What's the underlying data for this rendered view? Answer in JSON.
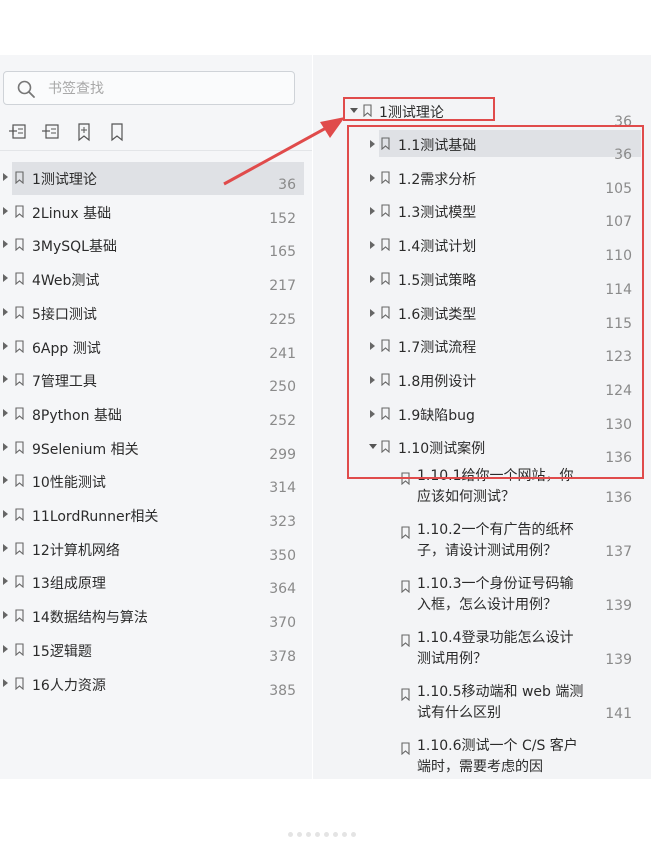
{
  "search": {
    "placeholder": "书签查找"
  },
  "toolbar": {
    "icons": [
      "expand-all-icon",
      "collapse-all-icon",
      "add-bookmark-icon",
      "bookmark-icon"
    ]
  },
  "left_outline": [
    {
      "label": "1测试理论",
      "page": "36",
      "selected": true
    },
    {
      "label": "2Linux 基础",
      "page": "152"
    },
    {
      "label": "3MySQL基础",
      "page": "165"
    },
    {
      "label": "4Web测试",
      "page": "217"
    },
    {
      "label": "5接口测试",
      "page": "225"
    },
    {
      "label": "6App 测试",
      "page": "241"
    },
    {
      "label": "7管理工具",
      "page": "250"
    },
    {
      "label": "8Python 基础",
      "page": "252"
    },
    {
      "label": "9Selenium 相关",
      "page": "299"
    },
    {
      "label": "10性能测试",
      "page": "314"
    },
    {
      "label": "11LordRunner相关",
      "page": "323"
    },
    {
      "label": "12计算机网络",
      "page": "350"
    },
    {
      "label": "13组成原理",
      "page": "364"
    },
    {
      "label": "14数据结构与算法",
      "page": "370"
    },
    {
      "label": "15逻辑题",
      "page": "378"
    },
    {
      "label": "16人力资源",
      "page": "385"
    }
  ],
  "right_outline": {
    "parent": {
      "label": "1测试理论",
      "page": "36"
    },
    "children": [
      {
        "label": "1.1测试基础",
        "page": "36",
        "selected": true
      },
      {
        "label": "1.2需求分析",
        "page": "105"
      },
      {
        "label": "1.3测试模型",
        "page": "107"
      },
      {
        "label": "1.4测试计划",
        "page": "110"
      },
      {
        "label": "1.5测试策略",
        "page": "114"
      },
      {
        "label": "1.6测试类型",
        "page": "115"
      },
      {
        "label": "1.7测试流程",
        "page": "123"
      },
      {
        "label": "1.8用例设计",
        "page": "124"
      },
      {
        "label": "1.9缺陷bug",
        "page": "130"
      },
      {
        "label": "1.10测试案例",
        "page": "136",
        "expanded": true
      }
    ],
    "subitems": [
      {
        "label": "1.10.1给你一个网站，你应该如何测试？",
        "page": "136"
      },
      {
        "label": "1.10.2一个有广告的纸杯子，请设计测试用例？",
        "page": "137"
      },
      {
        "label": "1.10.3一个身份证号码输入框，怎么设计用例？",
        "page": "139"
      },
      {
        "label": "1.10.4登录功能怎么设计测试用例？",
        "page": "139"
      },
      {
        "label": "1.10.5移动端和 web 端测试有什么区别",
        "page": "141"
      },
      {
        "label": "1.10.6测试一个 C/S 客户端时，需要考虑的因",
        "page": ""
      }
    ]
  },
  "colors": {
    "annotation_red": "#e04b4b",
    "selected_bg": "#dfe1e5",
    "panel_bg": "#f5f6f8"
  }
}
